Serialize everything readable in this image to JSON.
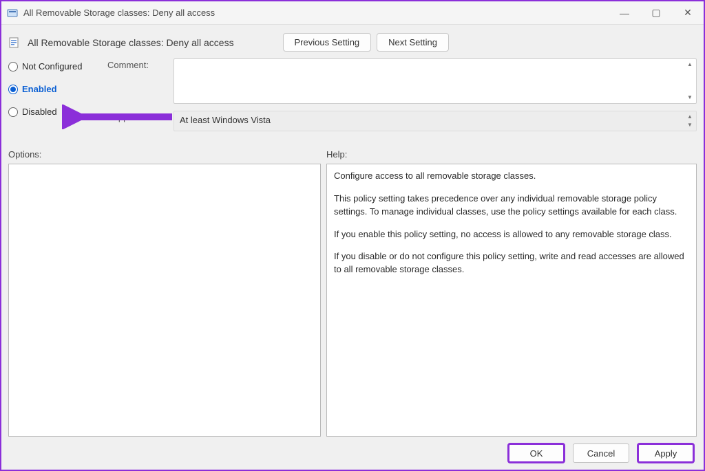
{
  "window": {
    "title": "All Removable Storage classes: Deny all access"
  },
  "header": {
    "policy_name": "All Removable Storage classes: Deny all access",
    "prev_btn": "Previous Setting",
    "next_btn": "Next Setting"
  },
  "state": {
    "not_configured": "Not Configured",
    "enabled": "Enabled",
    "disabled": "Disabled",
    "selected": "enabled"
  },
  "fields": {
    "comment_label": "Comment:",
    "comment_value": "",
    "supported_label": "Supported on:",
    "supported_value": "At least Windows Vista"
  },
  "sections": {
    "options_label": "Options:",
    "help_label": "Help:"
  },
  "help": {
    "p1": "Configure access to all removable storage classes.",
    "p2": "This policy setting takes precedence over any individual removable storage policy settings. To manage individual classes, use the policy settings available for each class.",
    "p3": "If you enable this policy setting, no access is allowed to any removable storage class.",
    "p4": "If you disable or do not configure this policy setting, write and read accesses are allowed to all removable storage classes."
  },
  "footer": {
    "ok": "OK",
    "cancel": "Cancel",
    "apply": "Apply"
  },
  "annotation": {
    "arrow_color": "#8b2fd9"
  }
}
